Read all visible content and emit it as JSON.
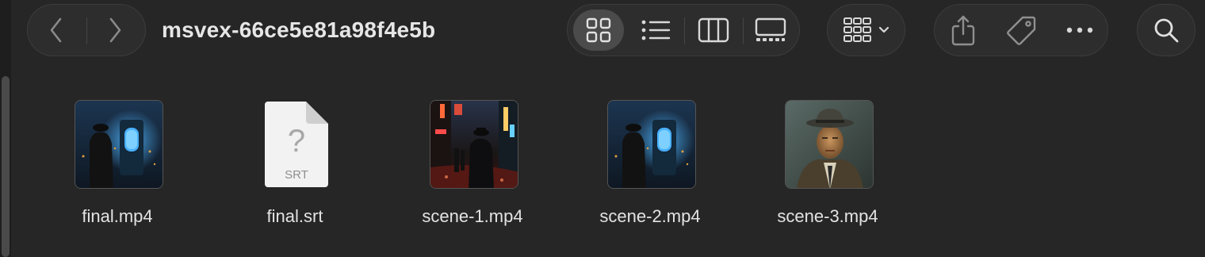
{
  "window": {
    "title": "msvex-66ce5e81a98f4e5b"
  },
  "toolbar": {
    "nav": [
      {
        "name": "back-button",
        "icon": "chevron-left-icon",
        "enabled": false
      },
      {
        "name": "forward-button",
        "icon": "chevron-right-icon",
        "enabled": false
      }
    ],
    "view_modes": [
      {
        "name": "icon-view",
        "icon": "grid-icon",
        "selected": true
      },
      {
        "name": "list-view",
        "icon": "list-icon",
        "selected": false
      },
      {
        "name": "column-view",
        "icon": "columns-icon",
        "selected": false
      },
      {
        "name": "gallery-view",
        "icon": "gallery-icon",
        "selected": false
      }
    ],
    "group_button_icon": "group-by-icon",
    "actions": [
      "share-icon",
      "tag-icon",
      "more-icon"
    ],
    "search_icon": "search-icon"
  },
  "files": [
    {
      "name": "final.mp4",
      "kind": "video"
    },
    {
      "name": "final.srt",
      "kind": "subtitle",
      "badge": "SRT",
      "glyph": "?"
    },
    {
      "name": "scene-1.mp4",
      "kind": "video"
    },
    {
      "name": "scene-2.mp4",
      "kind": "video"
    },
    {
      "name": "scene-3.mp4",
      "kind": "video"
    }
  ],
  "colors": {
    "window_bg": "#262626",
    "toolbar_pill": "#2d2d2d",
    "selected_segment": "#4b4b4b",
    "icon": "#d8d8d8",
    "text": "#e6e6e6"
  }
}
